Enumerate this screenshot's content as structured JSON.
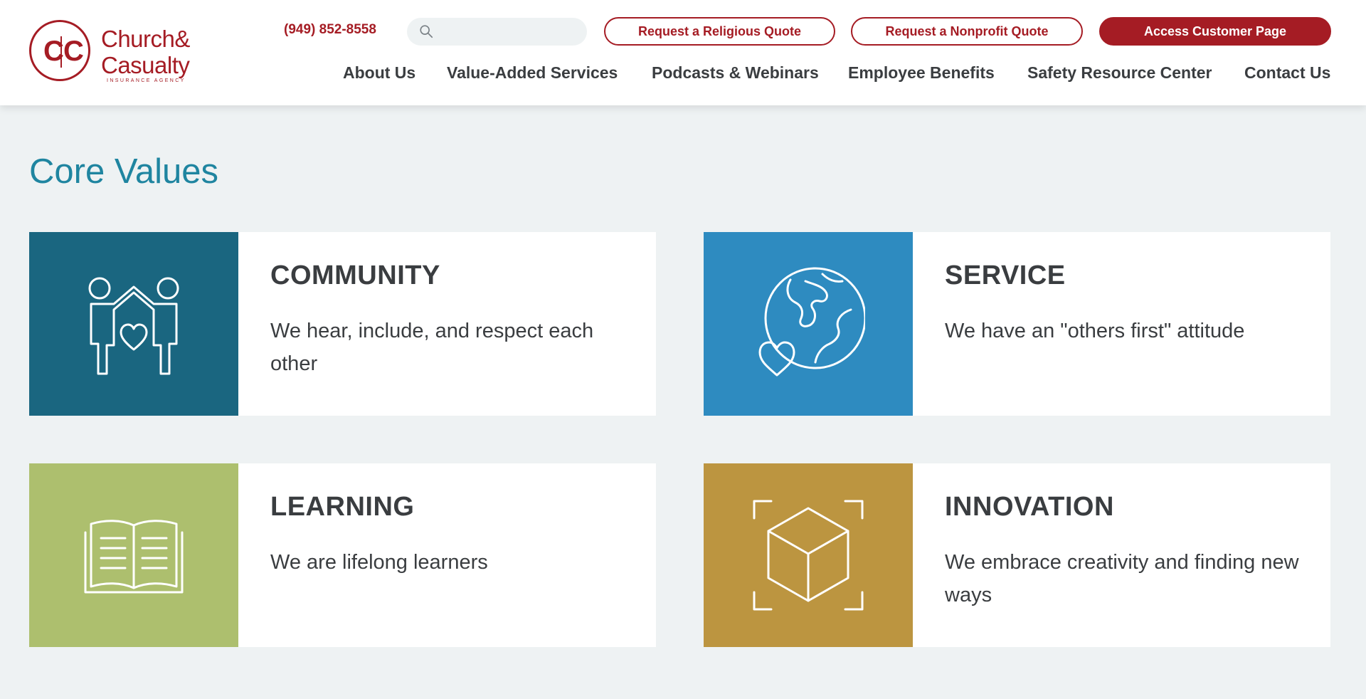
{
  "header": {
    "logo": {
      "brand_line1": "Church&",
      "brand_line2": "Casualty",
      "tagline": "INSURANCE AGENCY",
      "mark_letter_left": "C",
      "mark_letter_right": "C"
    },
    "phone": "(949) 852-8558",
    "search": {
      "placeholder": "",
      "value": "",
      "icon": "search-icon"
    },
    "buttons": {
      "religious_quote": "Request a Religious Quote",
      "nonprofit_quote": "Request a Nonprofit Quote",
      "customer_page": "Access Customer Page"
    },
    "nav": [
      {
        "label": "About Us"
      },
      {
        "label": "Value-Added Services"
      },
      {
        "label": "Podcasts & Webinars"
      },
      {
        "label": "Employee Benefits"
      },
      {
        "label": "Safety Resource Center"
      },
      {
        "label": "Contact Us"
      }
    ]
  },
  "main": {
    "title": "Core Values",
    "values": [
      {
        "heading": "COMMUNITY",
        "text": "We hear, include, and respect each other",
        "icon": "community-icon",
        "color": "#1a6680"
      },
      {
        "heading": "SERVICE",
        "text": "We have an \"others first\" attitude",
        "icon": "globe-heart-icon",
        "color": "#2e8bc0"
      },
      {
        "heading": "LEARNING",
        "text": "We are lifelong learners",
        "icon": "open-book-icon",
        "color": "#adbf6e"
      },
      {
        "heading": "INNOVATION",
        "text": "We embrace creativity and finding new ways",
        "icon": "cube-icon",
        "color": "#bc9540"
      }
    ]
  },
  "colors": {
    "brand_red": "#a51c24",
    "title_teal": "#1f85a0",
    "background": "#eef2f3",
    "text_dark": "#3a3d40"
  }
}
